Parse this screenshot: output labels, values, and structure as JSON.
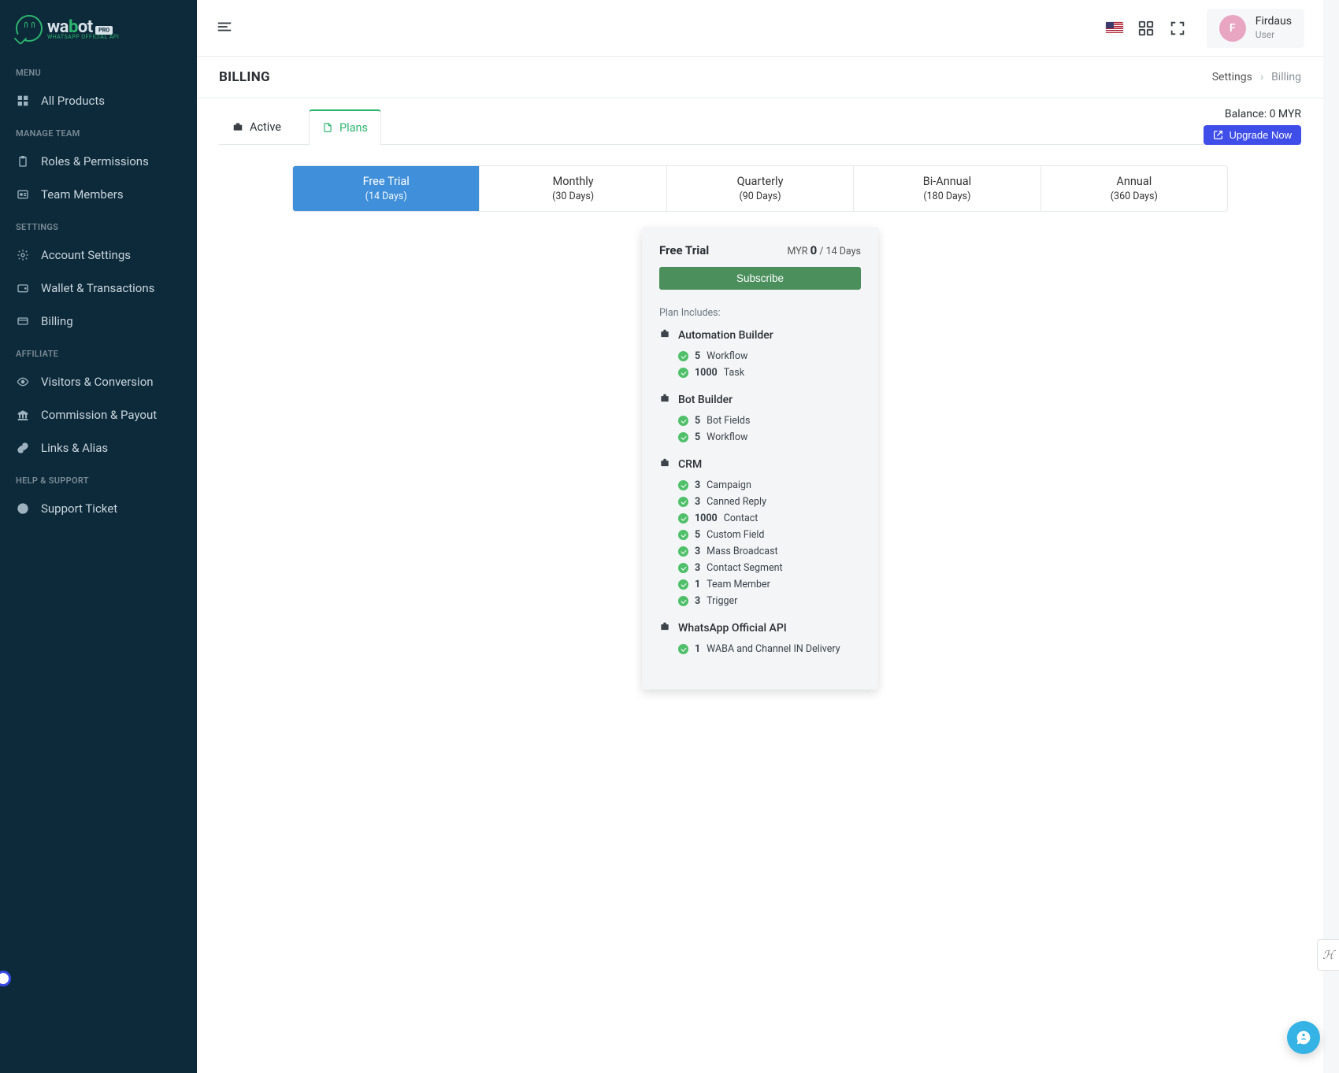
{
  "brand": {
    "name_prefix": "wa",
    "name_mid": "b",
    "name_suffix": "ot",
    "badge": "PRO",
    "sub": "WHATSAPP OFFICIAL API"
  },
  "user": {
    "initial": "F",
    "name": "Firdaus",
    "role": "User"
  },
  "page": {
    "title": "BILLING"
  },
  "breadcrumb": {
    "root": "Settings",
    "leaf": "Billing"
  },
  "sidebar": {
    "sections": [
      {
        "heading": "MENU",
        "items": [
          {
            "label": "All Products",
            "icon": "grid"
          }
        ]
      },
      {
        "heading": "MANAGE TEAM",
        "items": [
          {
            "label": "Roles & Permissions",
            "icon": "clipboard"
          },
          {
            "label": "Team Members",
            "icon": "users"
          }
        ]
      },
      {
        "heading": "SETTINGS",
        "items": [
          {
            "label": "Account Settings",
            "icon": "gear"
          },
          {
            "label": "Wallet & Transactions",
            "icon": "wallet"
          },
          {
            "label": "Billing",
            "icon": "card"
          }
        ]
      },
      {
        "heading": "AFFILIATE",
        "items": [
          {
            "label": "Visitors & Conversion",
            "icon": "eye"
          },
          {
            "label": "Commission & Payout",
            "icon": "bank"
          },
          {
            "label": "Links & Alias",
            "icon": "link"
          }
        ]
      },
      {
        "heading": "HELP & SUPPORT",
        "items": [
          {
            "label": "Support Ticket",
            "icon": "lifebuoy"
          }
        ]
      }
    ]
  },
  "tabs": {
    "active": "Active",
    "plans": "Plans"
  },
  "balance": {
    "label": "Balance:",
    "value": "0 MYR"
  },
  "upgrade_label": "Upgrade Now",
  "periods": [
    {
      "name": "Free Trial",
      "days": "(14 Days)",
      "selected": true
    },
    {
      "name": "Monthly",
      "days": "(30 Days)",
      "selected": false
    },
    {
      "name": "Quarterly",
      "days": "(90 Days)",
      "selected": false
    },
    {
      "name": "Bi-Annual",
      "days": "(180 Days)",
      "selected": false
    },
    {
      "name": "Annual",
      "days": "(360 Days)",
      "selected": false
    }
  ],
  "plan": {
    "name": "Free Trial",
    "currency": "MYR",
    "amount": "0",
    "per": "/ 14 Days",
    "subscribe": "Subscribe",
    "includes_label": "Plan Includes:",
    "groups": [
      {
        "title": "Automation Builder",
        "items": [
          {
            "num": "5",
            "label": "Workflow"
          },
          {
            "num": "1000",
            "label": "Task"
          }
        ]
      },
      {
        "title": "Bot Builder",
        "items": [
          {
            "num": "5",
            "label": "Bot Fields"
          },
          {
            "num": "5",
            "label": "Workflow"
          }
        ]
      },
      {
        "title": "CRM",
        "items": [
          {
            "num": "3",
            "label": "Campaign"
          },
          {
            "num": "3",
            "label": "Canned Reply"
          },
          {
            "num": "1000",
            "label": "Contact"
          },
          {
            "num": "5",
            "label": "Custom Field"
          },
          {
            "num": "3",
            "label": "Mass Broadcast"
          },
          {
            "num": "3",
            "label": "Contact Segment"
          },
          {
            "num": "1",
            "label": "Team Member"
          },
          {
            "num": "3",
            "label": "Trigger"
          }
        ]
      },
      {
        "title": "WhatsApp Official API",
        "items": [
          {
            "num": "1",
            "label": "WABA and Channel IN Delivery"
          }
        ]
      }
    ]
  }
}
